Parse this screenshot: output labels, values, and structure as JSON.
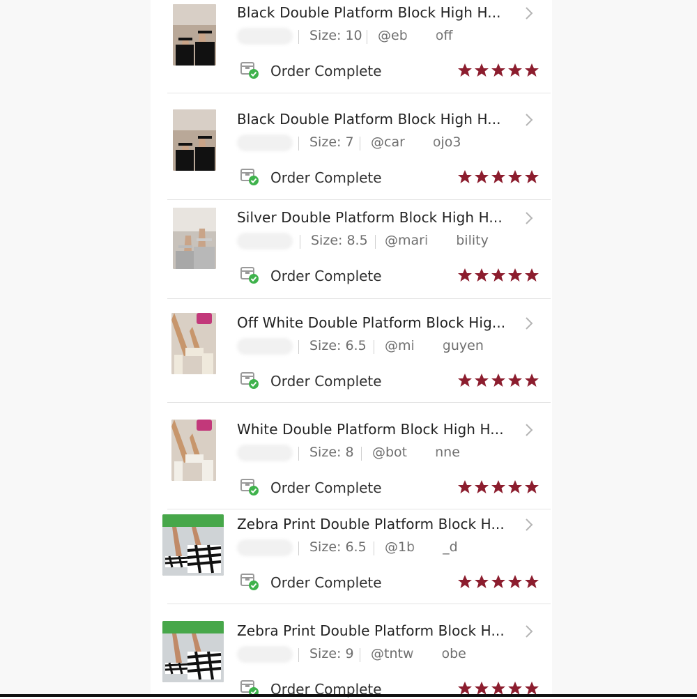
{
  "colors": {
    "star": "#8c1d2e",
    "status_check": "#3fb24c",
    "text_primary": "#222222",
    "text_secondary": "#6e6e6e"
  },
  "orders": [
    {
      "title": "Black Double Platform Block High H...",
      "size": "Size: 10",
      "user_start": "@eb",
      "user_end": "off",
      "status": "Order Complete",
      "rating": 5,
      "thumb": "black-platform-heels"
    },
    {
      "title": "Black Double Platform Block High H...",
      "size": "Size: 7",
      "user_start": "@car",
      "user_end": "ojo3",
      "status": "Order Complete",
      "rating": 5,
      "thumb": "black-platform-heels"
    },
    {
      "title": "Silver Double Platform Block High H...",
      "size": "Size: 8.5",
      "user_start": "@mari",
      "user_end": "bility",
      "status": "Order Complete",
      "rating": 5,
      "thumb": "silver-platform-heels"
    },
    {
      "title": "Off White Double Platform Block Hig...",
      "size": "Size: 6.5",
      "user_start": "@mi",
      "user_end": "guyen",
      "status": "Order Complete",
      "rating": 5,
      "thumb": "offwhite-platform-heels"
    },
    {
      "title": "White Double Platform Block High H...",
      "size": "Size: 8",
      "user_start": "@bot",
      "user_end": "nne",
      "status": "Order Complete",
      "rating": 5,
      "thumb": "white-platform-heels"
    },
    {
      "title": "Zebra Print Double Platform Block H...",
      "size": "Size: 6.5",
      "user_start": "@1b",
      "user_end": "_d",
      "status": "Order Complete",
      "rating": 5,
      "thumb": "zebra-platform-heels"
    },
    {
      "title": "Zebra Print Double Platform Block H...",
      "size": "Size: 9",
      "user_start": "@tntw",
      "user_end": "obe",
      "status": "Order Complete",
      "rating": 5,
      "thumb": "zebra-platform-heels"
    }
  ]
}
